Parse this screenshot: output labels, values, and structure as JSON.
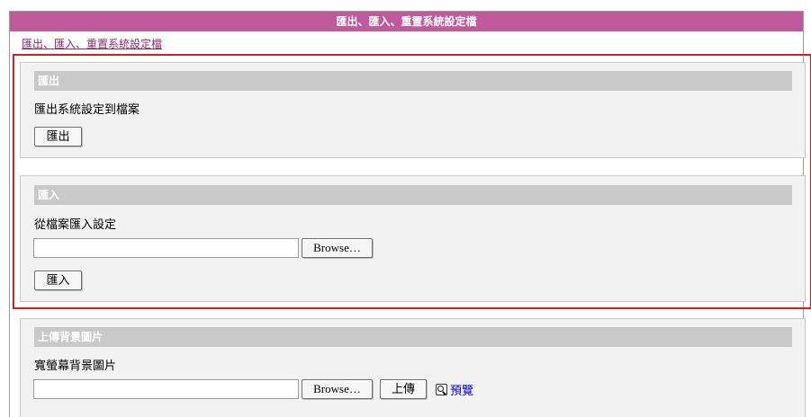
{
  "page": {
    "title": "匯出、匯入、重置系統設定檔",
    "breadcrumb": "匯出、匯入、重置系統設定檔"
  },
  "export_section": {
    "header": "匯出",
    "description": "匯出系統設定到檔案",
    "button_label": "匯出"
  },
  "import_section": {
    "header": "匯入",
    "description": "從檔案匯入設定",
    "file_value": "",
    "browse_label": "Browse…",
    "button_label": "匯入"
  },
  "background_section": {
    "header": "上傳背景圖片",
    "description": "寬螢幕背景圖片",
    "file_value": "",
    "browse_label": "Browse…",
    "upload_label": "上傳",
    "preview_label": "預覽"
  },
  "colors": {
    "title_bar": "#c05a9c",
    "section_header": "#c9c9c9",
    "highlight_border": "#d02020",
    "link": "#0000cc"
  }
}
